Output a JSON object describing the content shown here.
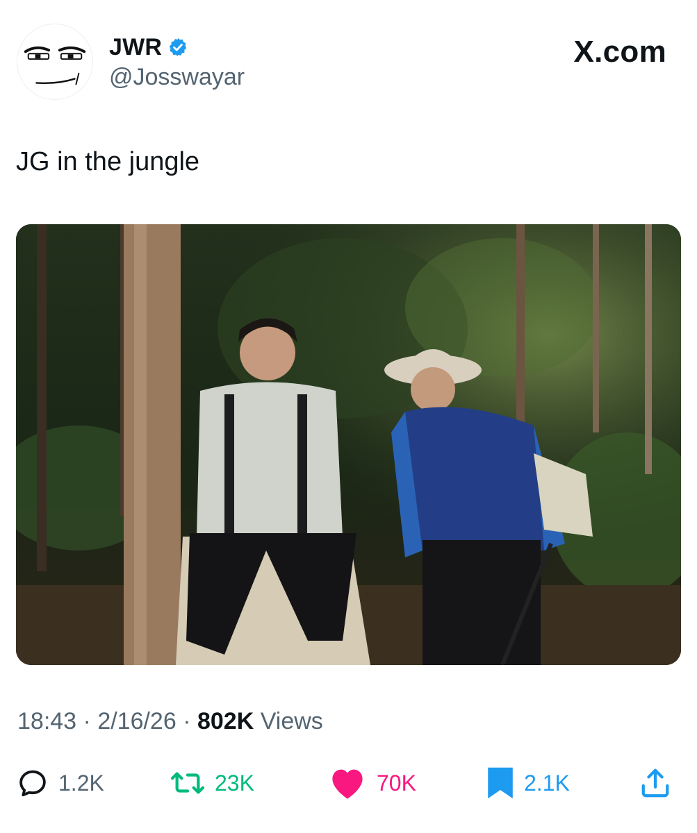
{
  "account": {
    "display_name": "JWR",
    "handle": "@Josswayar",
    "verified": true,
    "avatar_icon": "man-face-meme-avatar"
  },
  "site": {
    "label": "X.com"
  },
  "tweet": {
    "text": "JG in the jungle",
    "media_description_icon": "photo-two-hikers-in-jungle"
  },
  "meta": {
    "time": "18:43",
    "separator_1": " · ",
    "date": "2/16/26",
    "separator_2": " · ",
    "views_count": "802K",
    "views_label": " Views"
  },
  "actions": {
    "reply": {
      "icon": "reply-icon",
      "count": "1.2K"
    },
    "retweet": {
      "icon": "retweet-icon",
      "count": "23K"
    },
    "like": {
      "icon": "heart-icon",
      "count": "70K"
    },
    "bookmark": {
      "icon": "bookmark-icon",
      "count": "2.1K"
    },
    "share": {
      "icon": "share-icon"
    }
  },
  "colors": {
    "text_primary": "#0f1419",
    "text_secondary": "#536471",
    "verified": "#1d9bf0",
    "retweet": "#00ba7c",
    "like": "#f91880",
    "bookmark": "#1d9bf0"
  }
}
